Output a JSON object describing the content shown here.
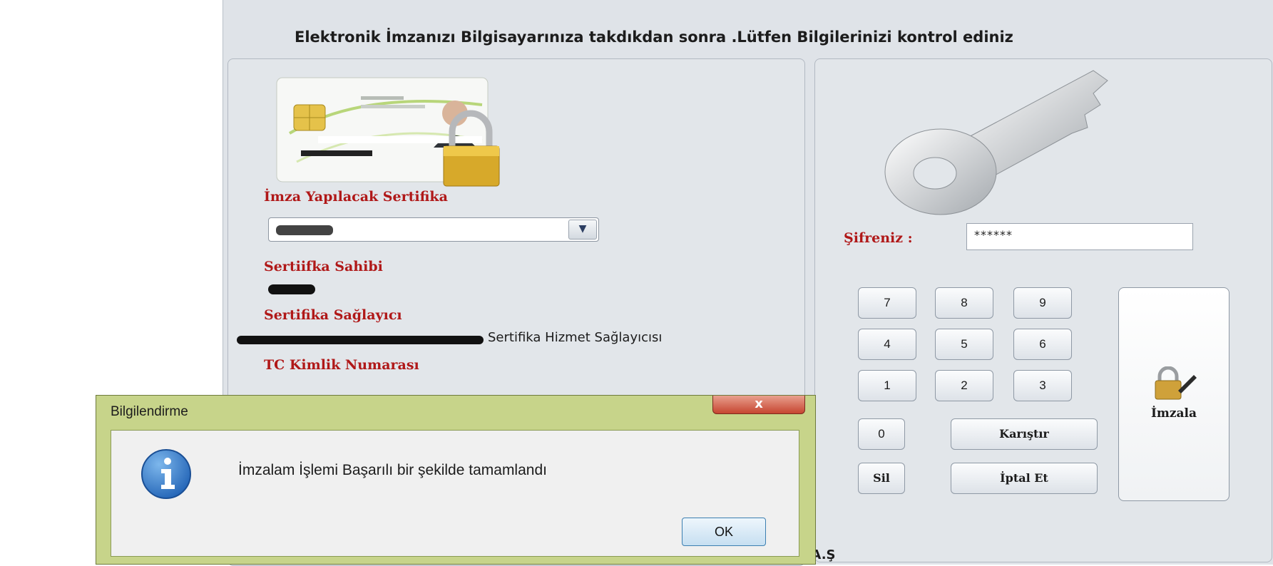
{
  "header": {
    "text": "Elektronik İmzanızı Bilgisayarınıza takdıkdan sonra .Lütfen Bilgilerinizi kontrol ediniz"
  },
  "left": {
    "cert_label": "İmza Yapılacak Sertifika",
    "owner_label": "Sertiifka Sahibi",
    "provider_label": "Sertifika Sağlayıcı",
    "provider_value": "Sertifika Hizmet Sağlayıcısı",
    "tc_label": "TC Kimlik Numarası"
  },
  "right": {
    "password_label": "Şifreniz :",
    "password_value": "******",
    "keys": [
      "7",
      "8",
      "9",
      "4",
      "5",
      "6",
      "1",
      "2",
      "3",
      "0"
    ],
    "shuffle_label": "Karıştır",
    "delete_label": "Sil",
    "cancel_label": "İptal Et",
    "sign_label": "İmzala"
  },
  "footer": {
    "fragment": "i A.Ş"
  },
  "dialog": {
    "title": "Bilgilendirme",
    "close_label": "x",
    "message": "İmzalam İşlemi Başarılı bir şekilde tamamlandı",
    "ok_label": "OK"
  },
  "colors": {
    "label_red": "#b01818",
    "panel_bg": "#e2e6ea",
    "dialog_frame": "#c7d48a"
  }
}
